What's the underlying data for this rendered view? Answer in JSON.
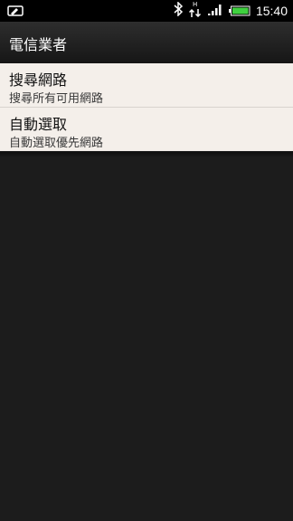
{
  "status_bar": {
    "time": "15:40",
    "icons": [
      "phone-sync-icon",
      "bluetooth-icon",
      "hspa-data-icon",
      "signal-icon",
      "battery-icon"
    ]
  },
  "title_bar": {
    "title": "電信業者"
  },
  "list": {
    "items": [
      {
        "primary": "搜尋網路",
        "secondary": "搜尋所有可用網路"
      },
      {
        "primary": "自動選取",
        "secondary": "自動選取優先網路"
      }
    ]
  },
  "colors": {
    "background": "#1c1c1c",
    "list_background": "#f4efea",
    "battery": "#3fd13f"
  }
}
